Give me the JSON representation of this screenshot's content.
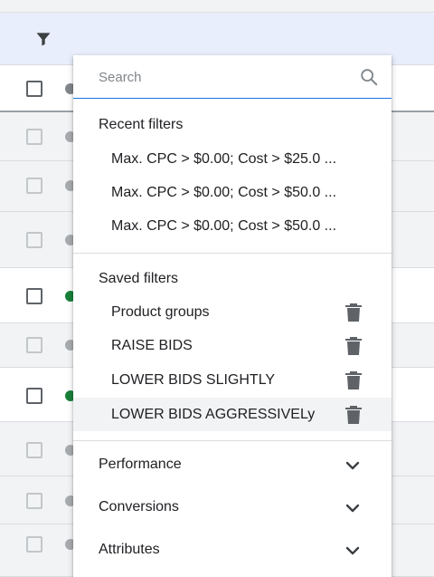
{
  "search": {
    "placeholder": "Search"
  },
  "recent": {
    "title": "Recent filters",
    "items": [
      "Max. CPC > $0.00; Cost > $25.0 ...",
      "Max. CPC > $0.00; Cost > $50.0 ...",
      "Max. CPC > $0.00; Cost > $50.0 ..."
    ]
  },
  "saved": {
    "title": "Saved filters",
    "items": [
      "Product groups",
      "RAISE BIDS",
      "LOWER BIDS SLIGHTLY",
      "LOWER BIDS AGGRESSIVELy"
    ]
  },
  "sections": [
    "Performance",
    "Conversions",
    "Attributes"
  ],
  "icons": {
    "filter": "filter-icon",
    "search": "search-icon",
    "trash": "trash-icon",
    "expand": "chevron-down-icon"
  },
  "colors": {
    "accent": "#1a73e8",
    "toolbar": "#e8eefc",
    "status_enabled": "#188038",
    "status_other": "#80868b"
  }
}
